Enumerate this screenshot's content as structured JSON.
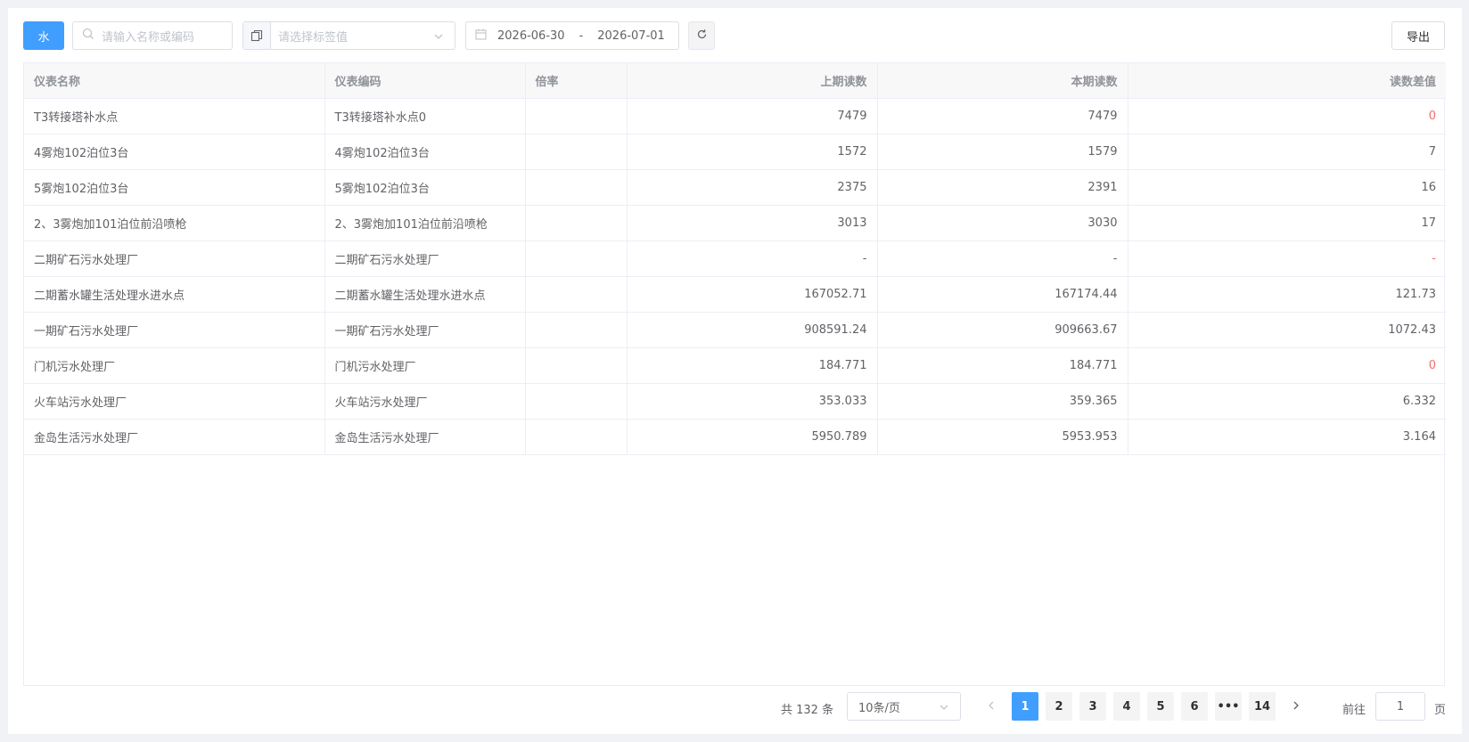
{
  "toolbar": {
    "type_button": "水",
    "search_placeholder": "请输入名称或编码",
    "tag_placeholder": "请选择标签值",
    "date_start": "2026-06-30",
    "date_separator": "-",
    "date_end": "2026-07-01",
    "export_label": "导出"
  },
  "table": {
    "headers": [
      "仪表名称",
      "仪表编码",
      "倍率",
      "上期读数",
      "本期读数",
      "读数差值"
    ],
    "rows": [
      {
        "name": "T3转接塔补水点",
        "code": "T3转接塔补水点0",
        "rate": "",
        "prev": "7479",
        "curr": "7479",
        "diff": "0"
      },
      {
        "name": "4雾炮102泊位3台",
        "code": "4雾炮102泊位3台",
        "rate": "",
        "prev": "1572",
        "curr": "1579",
        "diff": "7"
      },
      {
        "name": "5雾炮102泊位3台",
        "code": "5雾炮102泊位3台",
        "rate": "",
        "prev": "2375",
        "curr": "2391",
        "diff": "16"
      },
      {
        "name": "2、3雾炮加101泊位前沿喷枪",
        "code": "2、3雾炮加101泊位前沿喷枪",
        "rate": "",
        "prev": "3013",
        "curr": "3030",
        "diff": "17"
      },
      {
        "name": "二期矿石污水处理厂",
        "code": "二期矿石污水处理厂",
        "rate": "",
        "prev": "-",
        "curr": "-",
        "diff": "-"
      },
      {
        "name": "二期蓄水罐生活处理水进水点",
        "code": "二期蓄水罐生活处理水进水点",
        "rate": "",
        "prev": "167052.71",
        "curr": "167174.44",
        "diff": "121.73"
      },
      {
        "name": "一期矿石污水处理厂",
        "code": "一期矿石污水处理厂",
        "rate": "",
        "prev": "908591.24",
        "curr": "909663.67",
        "diff": "1072.43"
      },
      {
        "name": "门机污水处理厂",
        "code": "门机污水处理厂",
        "rate": "",
        "prev": "184.771",
        "curr": "184.771",
        "diff": "0"
      },
      {
        "name": "火车站污水处理厂",
        "code": "火车站污水处理厂",
        "rate": "",
        "prev": "353.033",
        "curr": "359.365",
        "diff": "6.332"
      },
      {
        "name": "金岛生活污水处理厂",
        "code": "金岛生活污水处理厂",
        "rate": "",
        "prev": "5950.789",
        "curr": "5953.953",
        "diff": "3.164"
      }
    ]
  },
  "pagination": {
    "total_text": "共 132 条",
    "page_size": "10条/页",
    "pages": [
      "1",
      "2",
      "3",
      "4",
      "5",
      "6",
      "•••",
      "14"
    ],
    "current_page": "1",
    "goto_label": "前往",
    "goto_value": "1",
    "page_suffix": "页"
  },
  "colors": {
    "primary": "#409eff",
    "zero_diff": "#f56c6c"
  },
  "icons": [
    "search-icon",
    "copy-icon",
    "chevron-down-icon",
    "calendar-icon",
    "refresh-icon",
    "chevron-left-icon",
    "chevron-right-icon"
  ]
}
